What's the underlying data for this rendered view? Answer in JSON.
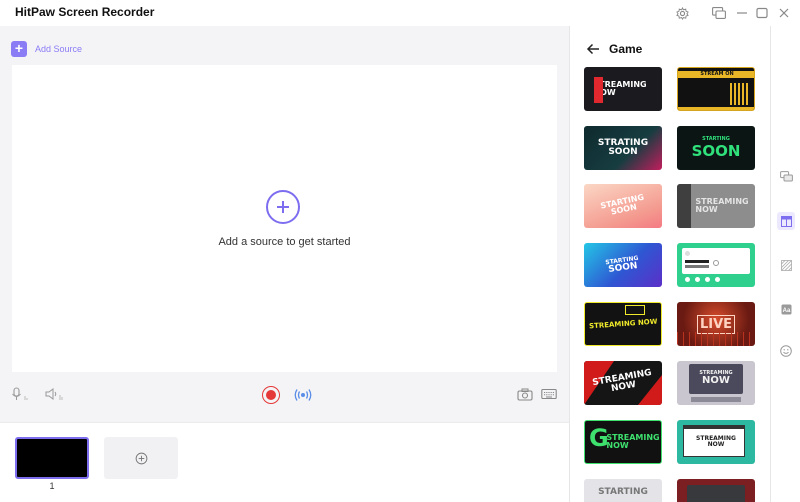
{
  "app": {
    "title": "HitPaw Screen Recorder",
    "accent": "#7d6ef0",
    "record_color": "#e53838"
  },
  "titlebar_icons": [
    "settings-icon",
    "feedback-icon",
    "minimize-icon",
    "maximize-icon",
    "close-icon"
  ],
  "workspace": {
    "add_source_label": "Add Source",
    "hint": "Add a source to get started"
  },
  "controls": [
    "microphone-icon",
    "speaker-icon",
    "record-icon",
    "live-stream-icon",
    "camera-icon",
    "keyboard-icon"
  ],
  "scenes": [
    {
      "number": "1"
    }
  ],
  "panel": {
    "title": "Game",
    "templates": [
      {
        "line1": "STREAMING",
        "line2": "NOW"
      },
      {
        "line1": "STREAM ON",
        "line2": ""
      },
      {
        "line1": "STRATING",
        "line2": "SOON"
      },
      {
        "line1": "STARTING",
        "line2": "SOON"
      },
      {
        "line1": "STARTING",
        "line2": "SOON"
      },
      {
        "line1": "STREAMING",
        "line2": "NOW"
      },
      {
        "line1": "STARTING",
        "line2": "SOON"
      },
      {
        "line1": "",
        "line2": ""
      },
      {
        "line1": "STREAMING NOW",
        "line2": ""
      },
      {
        "line1": "LIVE",
        "line2": ""
      },
      {
        "line1": "STREAMING",
        "line2": "NOW"
      },
      {
        "line1": "STREAMING",
        "line2": "NOW"
      },
      {
        "line1": "STREAMING",
        "line2": "NOW"
      },
      {
        "line1": "STREAMING",
        "line2": "NOW"
      },
      {
        "line1": "STARTING",
        "line2": ""
      },
      {
        "line1": "",
        "line2": ""
      }
    ]
  },
  "side_rail": [
    "chat-icon",
    "layout-icon",
    "pattern-icon",
    "text-icon",
    "emoji-icon"
  ]
}
